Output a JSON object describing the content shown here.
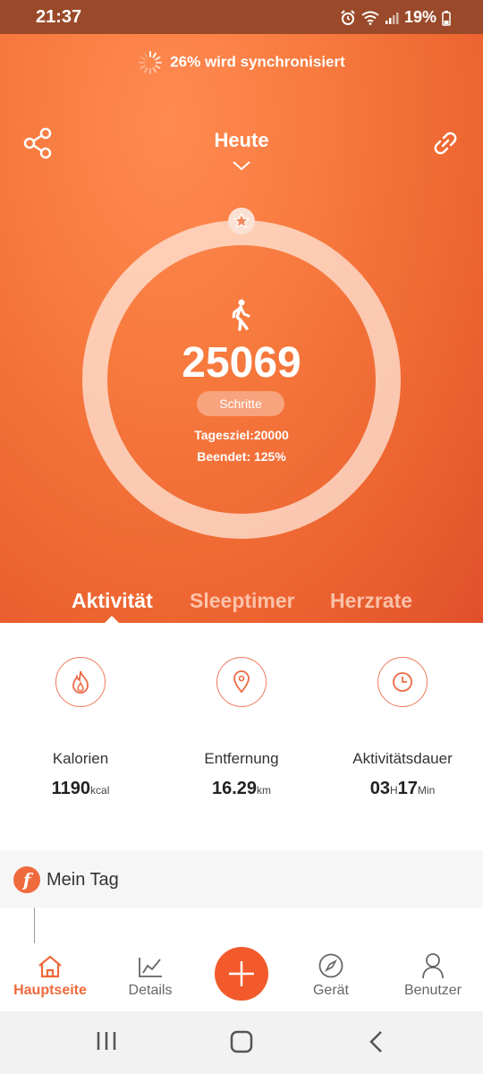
{
  "status_bar": {
    "time": "21:37",
    "battery": "19%"
  },
  "sync": {
    "text": "26% wird synchronisiert"
  },
  "header": {
    "title": "Heute"
  },
  "ring": {
    "steps": "25069",
    "steps_label": "Schritte",
    "goal": "Tagesziel:20000",
    "completed": "Beendet: 125%",
    "progress": 1.25
  },
  "tabs": [
    {
      "label": "Aktivität",
      "active": true
    },
    {
      "label": "Sleeptimer",
      "active": false
    },
    {
      "label": "Herzrate",
      "active": false
    }
  ],
  "metrics": [
    {
      "label": "Kalorien",
      "value": "1190",
      "unit": "kcal",
      "icon": "flame-icon"
    },
    {
      "label": "Entfernung",
      "value": "16.29",
      "unit": "km",
      "icon": "location-pin-icon"
    },
    {
      "label": "Aktivitätsdauer",
      "hours": "03",
      "hours_unit": "H",
      "minutes": "17",
      "minutes_unit": "Min",
      "icon": "clock-icon"
    }
  ],
  "my_day": {
    "title": "Mein Tag",
    "logo_letter": "f"
  },
  "bottom_nav": [
    {
      "label": "Hauptseite",
      "icon": "home-icon",
      "active": true
    },
    {
      "label": "Details",
      "icon": "chart-icon",
      "active": false
    },
    {
      "label": "Gerät",
      "icon": "compass-icon",
      "active": false
    },
    {
      "label": "Benutzer",
      "icon": "user-icon",
      "active": false
    }
  ],
  "colors": {
    "accent": "#f25a2c",
    "hero_start": "#ff8a52",
    "hero_end": "#e0502a"
  }
}
